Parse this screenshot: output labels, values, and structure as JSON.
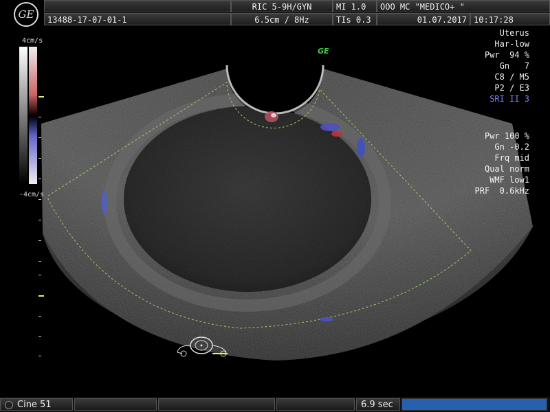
{
  "header": {
    "logo_text": "GE",
    "probe": "RIC 5-9H/GYN",
    "mi": "MI  1.0",
    "institution": "OOO  MC \"MEDICO+ \"",
    "patient_id": "13488-17-07-01-1",
    "depth_freq": "6.5cm /  8Hz",
    "tis": "TIs  0.3",
    "date": "01.07.2017",
    "time": "10:17:28"
  },
  "colorscale": {
    "top_label": "4cm/s",
    "bottom_label": "-4cm/s"
  },
  "params_bmode": [
    "Uterus",
    "Har-low",
    "Pwr  94 %",
    "Gn   7",
    "C8 / M5",
    "P2 / E3",
    "SRI II 3"
  ],
  "params_color": [
    "Pwr 100 %",
    "Gn -0.2",
    "Frq mid",
    "Qual norm",
    "WMF low1",
    "PRF  0.6kHz"
  ],
  "ge_mark": "GE",
  "footer": {
    "cine_label": "Cine 51",
    "duration": "6.9 sec",
    "progress": 1.0
  },
  "colors": {
    "sri_label": "#8080ff",
    "accent": "#2860b0"
  }
}
